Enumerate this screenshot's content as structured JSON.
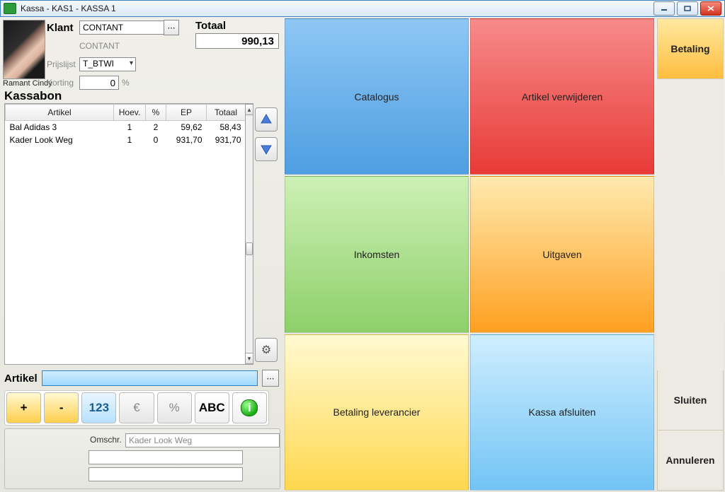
{
  "window": {
    "title": "Kassa - KAS1 - KASSA 1"
  },
  "user": {
    "name": "Ramant Cindy"
  },
  "customer": {
    "label": "Klant",
    "value": "CONTANT",
    "display": "CONTANT",
    "pricelist_label": "Prijslijst",
    "pricelist": "T_BTWI",
    "discount_label": "Korting",
    "discount": "0",
    "discount_suffix": "%"
  },
  "total": {
    "label": "Totaal",
    "value": "990,13"
  },
  "receipt": {
    "title": "Kassabon",
    "headers": {
      "artikel": "Artikel",
      "hoev": "Hoev.",
      "pct": "%",
      "ep": "EP",
      "totaal": "Totaal"
    },
    "rows": [
      {
        "artikel": "Bal Adidas 3",
        "hoev": "1",
        "pct": "2",
        "ep": "59,62",
        "totaal": "58,43"
      },
      {
        "artikel": "Kader Look Weg",
        "hoev": "1",
        "pct": "0",
        "ep": "931,70",
        "totaal": "931,70"
      }
    ]
  },
  "artikel": {
    "label": "Artikel"
  },
  "keypad": {
    "plus": "+",
    "minus": "-",
    "k123": "123",
    "euro": "€",
    "pct": "%",
    "abc": "ABC",
    "info": "i"
  },
  "desc": {
    "label": "Omschr.",
    "value": "Kader Look Weg"
  },
  "tiles": {
    "catalogus": "Catalogus",
    "artikel_verwijderen": "Artikel verwijderen",
    "inkomsten": "Inkomsten",
    "uitgaven": "Uitgaven",
    "betaling_leverancier": "Betaling leverancier",
    "kassa_afsluiten": "Kassa afsluiten"
  },
  "right": {
    "betaling": "Betaling",
    "sluiten": "Sluiten",
    "annuleren": "Annuleren"
  }
}
